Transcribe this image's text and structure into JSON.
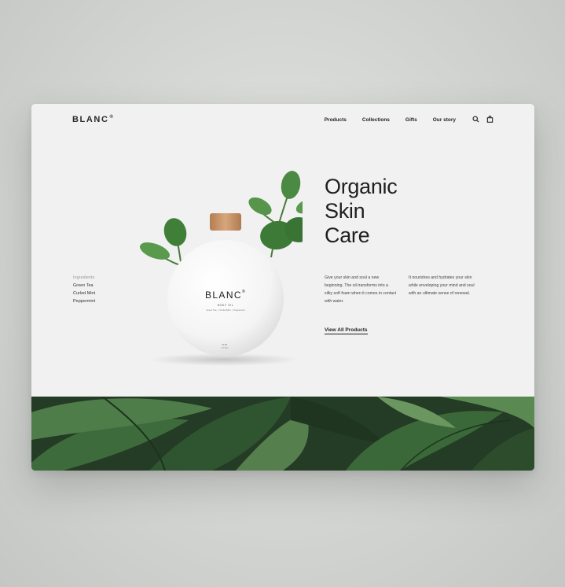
{
  "nav": {
    "logo": "BLANC",
    "logo_mark": "®",
    "links": [
      "Products",
      "Collections",
      "Gifts",
      "Our story"
    ],
    "icons": [
      "search-icon",
      "bag-icon"
    ]
  },
  "ingredients": {
    "label": "Ingredients",
    "items": [
      "Green Tea",
      "Curled Mint",
      "Peppermint"
    ]
  },
  "hero": {
    "title_lines": [
      "Organic",
      "Skin",
      "Care"
    ],
    "desc_left": "Give your skin and soul a new beginning. The oil transforms into a silky soft foam when it comes in contact with water.",
    "desc_right": "It nourishes and hydrates your skin while enveloping your mind and soul with an ultimate sense of renewal.",
    "cta": "View All Products"
  },
  "product": {
    "brand": "BLANC",
    "brand_mark": "®",
    "type": "BODY OIL",
    "ingredients_line": "Green Tea  |  Curled Mint  |  Peppermint",
    "volume": "80 ML",
    "volume_oz": "2.7 fl.oz"
  },
  "colors": {
    "background": "#f1f1f1",
    "text": "#1f1f1f",
    "leaf_dark": "#2f4a30",
    "leaf_green": "#4f8f45",
    "cap_wood": "#c9936a"
  }
}
